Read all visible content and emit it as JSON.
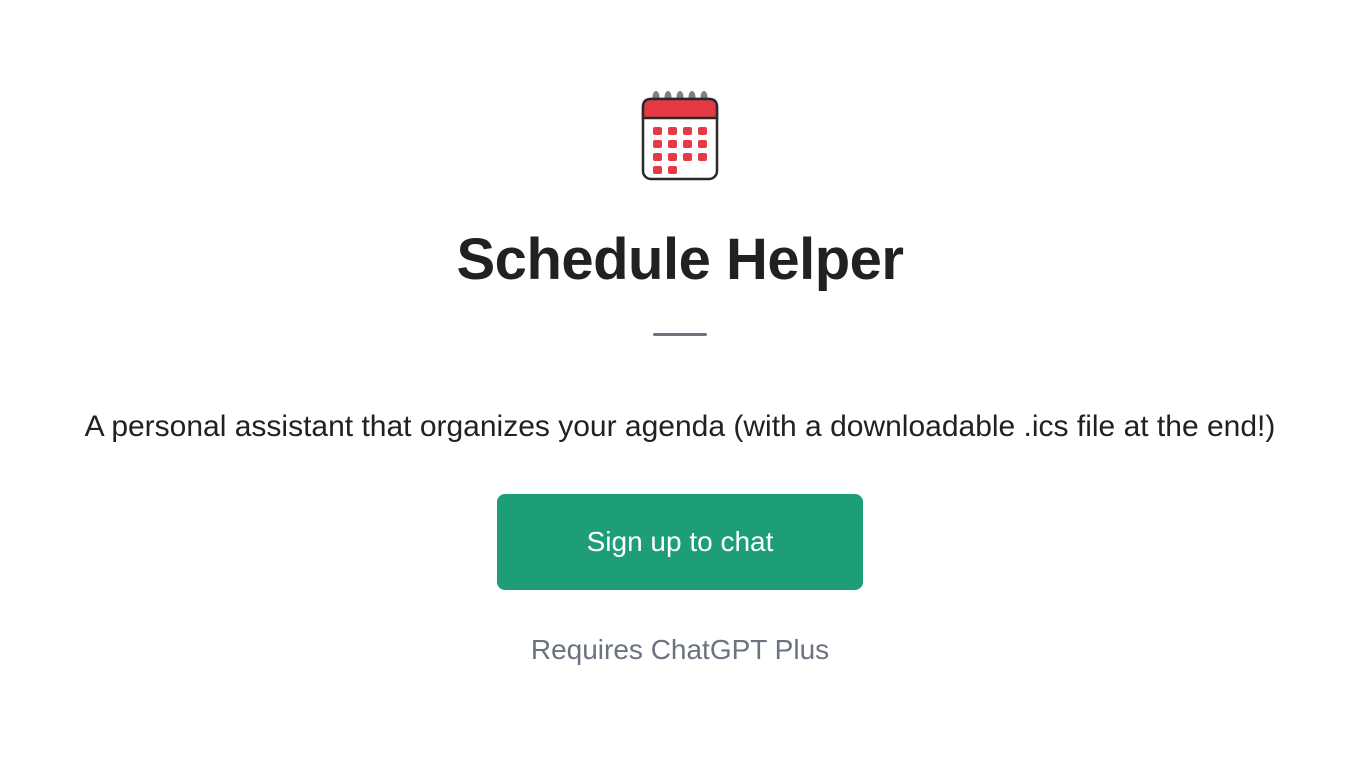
{
  "app": {
    "title": "Schedule Helper",
    "description": "A personal assistant that organizes your agenda (with a downloadable .ics file at the end!)",
    "signup_label": "Sign up to chat",
    "requires_text": "Requires ChatGPT Plus",
    "icon_name": "calendar-icon"
  }
}
